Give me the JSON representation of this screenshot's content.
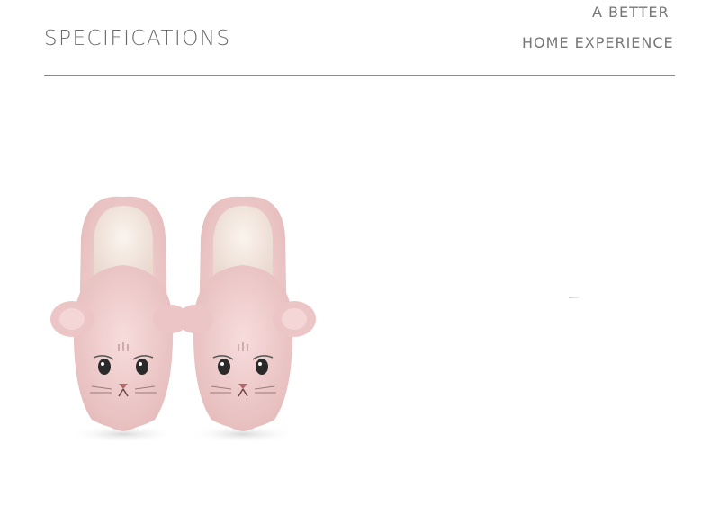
{
  "header": {
    "title": "SPECIFICATIONS",
    "tagline_line1": "A BETTER",
    "tagline_line2": "HOME EXPERIENCE"
  },
  "product_image": {
    "description_icon": "cat-slippers-image",
    "colors": {
      "body": "#f0cfcf",
      "lining": "#f6ece4",
      "eyes": "#2a2a2a"
    }
  }
}
